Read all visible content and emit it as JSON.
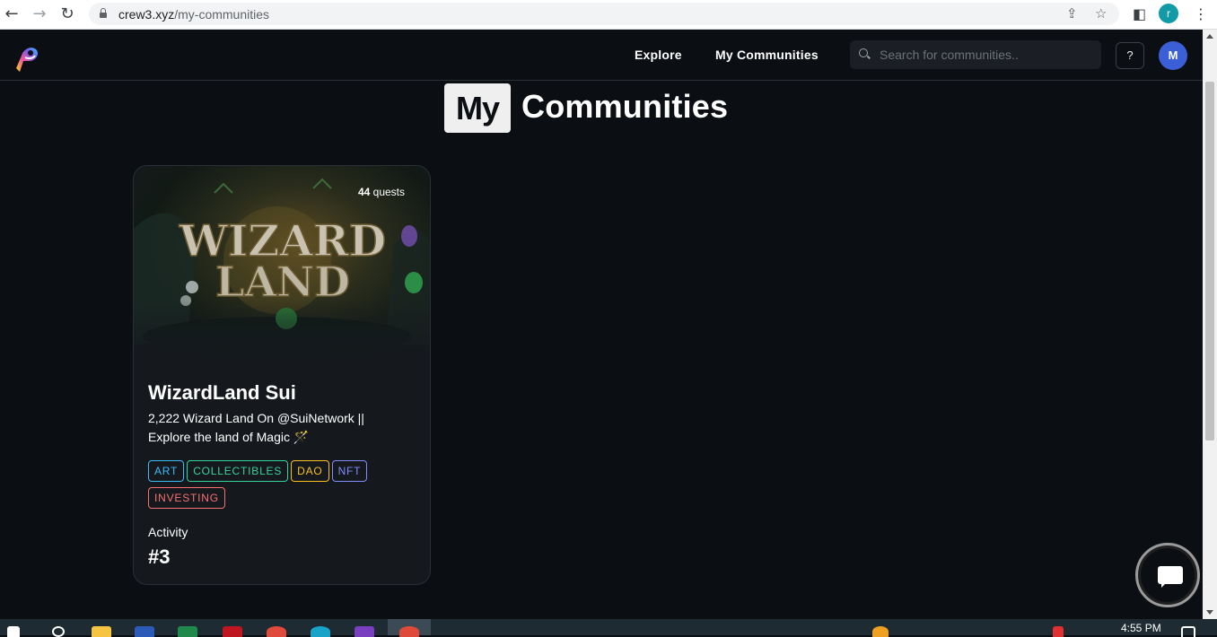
{
  "browser": {
    "url_host": "crew3.xyz",
    "url_path": "/my-communities",
    "profile_initial": "r"
  },
  "header": {
    "nav": [
      {
        "label": "Explore"
      },
      {
        "label": "My Communities"
      }
    ],
    "search": {
      "placeholder": "Search for communities.."
    },
    "help_label": "?",
    "avatar_initial": "M"
  },
  "page": {
    "title_highlight": "My",
    "title_rest": "Communities"
  },
  "communities": [
    {
      "quest_count": "44",
      "quest_label": "quests",
      "name": "WizardLand Sui",
      "banner_text_line1": "WIZARD",
      "banner_text_line2": "LAND",
      "description": "2,222 Wizard Land On @SuiNetwork || Explore the land of Magic 🪄",
      "tags": [
        {
          "label": "ART",
          "color": "#38bdf8"
        },
        {
          "label": "COLLECTIBLES",
          "color": "#34d399"
        },
        {
          "label": "DAO",
          "color": "#fbbf24"
        },
        {
          "label": "NFT",
          "color": "#818cf8"
        },
        {
          "label": "INVESTING",
          "color": "#f87171"
        }
      ],
      "activity_label": "Activity",
      "activity_rank": "#3"
    }
  ],
  "taskbar": {
    "time": "4:55 PM"
  }
}
